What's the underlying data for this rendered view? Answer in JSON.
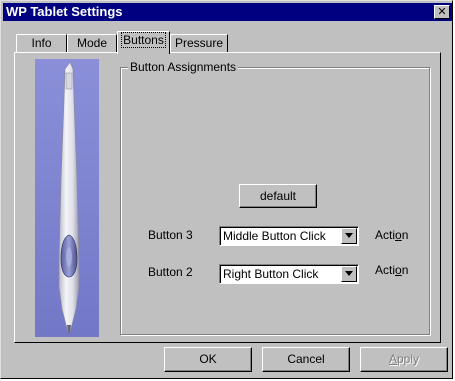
{
  "window": {
    "title": "WP Tablet Settings",
    "close_glyph": "✕"
  },
  "tabs": [
    {
      "label": "Info",
      "active": false
    },
    {
      "label": "Mode",
      "active": false
    },
    {
      "label": "Buttons",
      "active": true
    },
    {
      "label": "Pressure",
      "active": false
    }
  ],
  "panel": {
    "image_icon": "stylus-pen-image",
    "group_title": "Button Assignments",
    "default_button": "default",
    "rows": [
      {
        "label": "Button 3",
        "value": "Middle Button Click",
        "action_pre": "Acti",
        "action_mnemonic": "o",
        "action_post": "n"
      },
      {
        "label": "Button 2",
        "value": "Right Button Click",
        "action_pre": "Acti",
        "action_mnemonic": "o",
        "action_post": "n"
      }
    ]
  },
  "footer": {
    "ok": "OK",
    "cancel": "Cancel",
    "apply_mnemonic": "A",
    "apply_rest": "pply"
  },
  "colors": {
    "titlebar": "#000080",
    "face": "#c0c0c0",
    "pen_background": "#7e84d0"
  }
}
